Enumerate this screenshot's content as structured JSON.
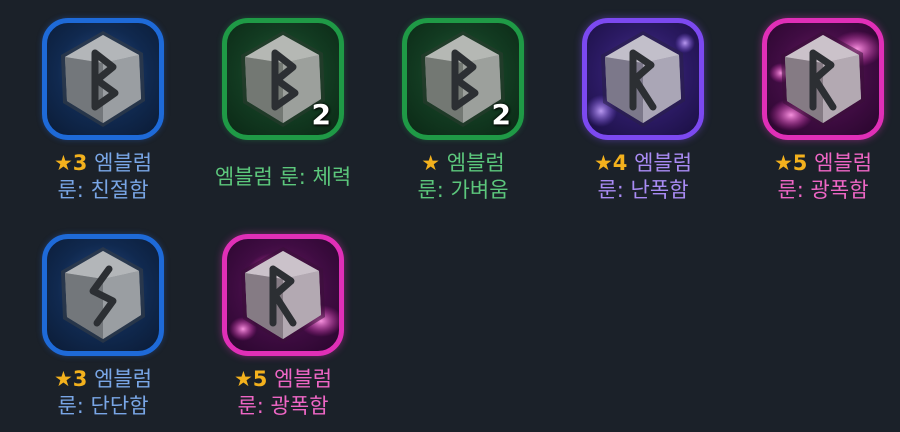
{
  "items": [
    {
      "id": "emblem-kindness",
      "rarity": "blue",
      "rune_icon": "rune-b-icon",
      "count": "",
      "star": "★",
      "star_count": "3",
      "line1": "엠블럼",
      "line2": "룬: 친절함"
    },
    {
      "id": "emblem-stamina",
      "rarity": "green",
      "rune_icon": "rune-b-icon",
      "count": "2",
      "star": "",
      "star_count": "",
      "line1": "엠블럼 룬: 체력",
      "line2": ""
    },
    {
      "id": "emblem-lightness",
      "rarity": "green",
      "rune_icon": "rune-b-icon",
      "count": "2",
      "star": "★",
      "star_count": "",
      "line1": "엠블럼",
      "line2": "룬: 가벼움"
    },
    {
      "id": "emblem-violence",
      "rarity": "purple",
      "rune_icon": "rune-r-icon",
      "count": "",
      "star": "★",
      "star_count": "4",
      "line1": "엠블럼",
      "line2": "룬: 난폭함"
    },
    {
      "id": "emblem-ferocity-1",
      "rarity": "pink",
      "rune_icon": "rune-r-icon",
      "count": "",
      "star": "★",
      "star_count": "5",
      "line1": "엠블럼",
      "line2": "룬: 광폭함"
    },
    {
      "id": "emblem-firmness",
      "rarity": "blue",
      "rune_icon": "rune-sowilo-icon",
      "count": "",
      "star": "★",
      "star_count": "3",
      "line1": "엠블럼",
      "line2": "룬: 단단함"
    },
    {
      "id": "emblem-ferocity-2",
      "rarity": "pink",
      "rune_icon": "rune-r-icon",
      "count": "",
      "star": "★",
      "star_count": "5",
      "line1": "엠블럼",
      "line2": "룬: 광폭함"
    }
  ],
  "colors": {
    "background": "#1b2129",
    "star": "#f3b11d",
    "blue": "#1e6ad8",
    "green": "#1f9a46",
    "purple": "#7c49f0",
    "pink": "#e02fb7"
  }
}
